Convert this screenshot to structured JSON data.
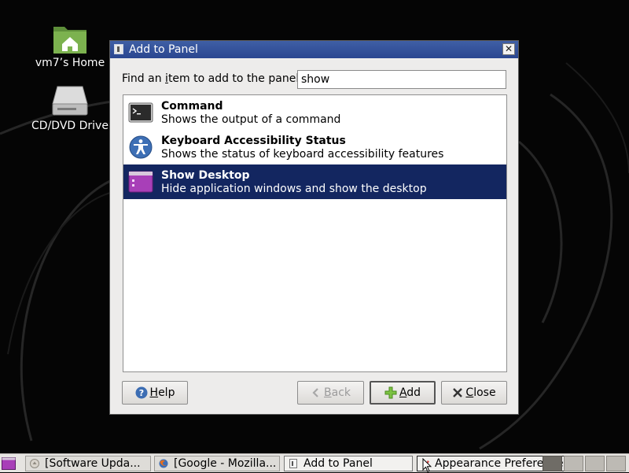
{
  "desktop": {
    "icons": [
      {
        "label": "vm7’s Home",
        "icon": "home-folder-icon"
      },
      {
        "label": "CD/DVD Drive",
        "icon": "optical-drive-icon"
      }
    ]
  },
  "dialog": {
    "title": "Add to Panel",
    "find_label_pre": "Find an ",
    "find_label_mnemonic": "i",
    "find_label_post": "tem to add to the panel:",
    "search_value": "show",
    "items": [
      {
        "name": "Command",
        "description": "Shows the output of a command",
        "icon": "terminal-icon",
        "selected": false
      },
      {
        "name": "Keyboard Accessibility Status",
        "description": "Shows the status of keyboard accessibility features",
        "icon": "accessibility-icon",
        "selected": false
      },
      {
        "name": "Show Desktop",
        "description": "Hide application windows and show the desktop",
        "icon": "show-desktop-icon",
        "selected": true
      }
    ],
    "buttons": {
      "help_mnemonic": "H",
      "help_rest": "elp",
      "back_mnemonic": "B",
      "back_rest": "ack",
      "add_mnemonic": "A",
      "add_rest": "dd",
      "close_mnemonic": "C",
      "close_rest": "lose"
    },
    "colors": {
      "title_bar": "#2f4c96",
      "selection": "#132660"
    }
  },
  "taskbar": {
    "tasks": [
      {
        "label": "[Software Upda...",
        "icon": "update-icon"
      },
      {
        "label": "[Google - Mozilla...",
        "icon": "firefox-icon"
      },
      {
        "label": "Add to Panel",
        "icon": "window-icon",
        "active": true
      },
      {
        "label": "Appearance Preferences",
        "icon": "appearance-icon"
      }
    ]
  }
}
